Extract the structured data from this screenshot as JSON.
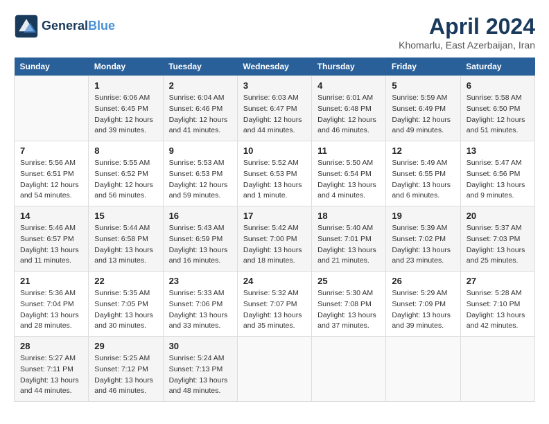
{
  "header": {
    "logo_line1": "General",
    "logo_line2": "Blue",
    "month_title": "April 2024",
    "subtitle": "Khomarlu, East Azerbaijan, Iran"
  },
  "weekdays": [
    "Sunday",
    "Monday",
    "Tuesday",
    "Wednesday",
    "Thursday",
    "Friday",
    "Saturday"
  ],
  "weeks": [
    [
      null,
      {
        "day": "1",
        "sunrise": "6:06 AM",
        "sunset": "6:45 PM",
        "daylight": "12 hours and 39 minutes."
      },
      {
        "day": "2",
        "sunrise": "6:04 AM",
        "sunset": "6:46 PM",
        "daylight": "12 hours and 41 minutes."
      },
      {
        "day": "3",
        "sunrise": "6:03 AM",
        "sunset": "6:47 PM",
        "daylight": "12 hours and 44 minutes."
      },
      {
        "day": "4",
        "sunrise": "6:01 AM",
        "sunset": "6:48 PM",
        "daylight": "12 hours and 46 minutes."
      },
      {
        "day": "5",
        "sunrise": "5:59 AM",
        "sunset": "6:49 PM",
        "daylight": "12 hours and 49 minutes."
      },
      {
        "day": "6",
        "sunrise": "5:58 AM",
        "sunset": "6:50 PM",
        "daylight": "12 hours and 51 minutes."
      }
    ],
    [
      {
        "day": "7",
        "sunrise": "5:56 AM",
        "sunset": "6:51 PM",
        "daylight": "12 hours and 54 minutes."
      },
      {
        "day": "8",
        "sunrise": "5:55 AM",
        "sunset": "6:52 PM",
        "daylight": "12 hours and 56 minutes."
      },
      {
        "day": "9",
        "sunrise": "5:53 AM",
        "sunset": "6:53 PM",
        "daylight": "12 hours and 59 minutes."
      },
      {
        "day": "10",
        "sunrise": "5:52 AM",
        "sunset": "6:53 PM",
        "daylight": "13 hours and 1 minute."
      },
      {
        "day": "11",
        "sunrise": "5:50 AM",
        "sunset": "6:54 PM",
        "daylight": "13 hours and 4 minutes."
      },
      {
        "day": "12",
        "sunrise": "5:49 AM",
        "sunset": "6:55 PM",
        "daylight": "13 hours and 6 minutes."
      },
      {
        "day": "13",
        "sunrise": "5:47 AM",
        "sunset": "6:56 PM",
        "daylight": "13 hours and 9 minutes."
      }
    ],
    [
      {
        "day": "14",
        "sunrise": "5:46 AM",
        "sunset": "6:57 PM",
        "daylight": "13 hours and 11 minutes."
      },
      {
        "day": "15",
        "sunrise": "5:44 AM",
        "sunset": "6:58 PM",
        "daylight": "13 hours and 13 minutes."
      },
      {
        "day": "16",
        "sunrise": "5:43 AM",
        "sunset": "6:59 PM",
        "daylight": "13 hours and 16 minutes."
      },
      {
        "day": "17",
        "sunrise": "5:42 AM",
        "sunset": "7:00 PM",
        "daylight": "13 hours and 18 minutes."
      },
      {
        "day": "18",
        "sunrise": "5:40 AM",
        "sunset": "7:01 PM",
        "daylight": "13 hours and 21 minutes."
      },
      {
        "day": "19",
        "sunrise": "5:39 AM",
        "sunset": "7:02 PM",
        "daylight": "13 hours and 23 minutes."
      },
      {
        "day": "20",
        "sunrise": "5:37 AM",
        "sunset": "7:03 PM",
        "daylight": "13 hours and 25 minutes."
      }
    ],
    [
      {
        "day": "21",
        "sunrise": "5:36 AM",
        "sunset": "7:04 PM",
        "daylight": "13 hours and 28 minutes."
      },
      {
        "day": "22",
        "sunrise": "5:35 AM",
        "sunset": "7:05 PM",
        "daylight": "13 hours and 30 minutes."
      },
      {
        "day": "23",
        "sunrise": "5:33 AM",
        "sunset": "7:06 PM",
        "daylight": "13 hours and 33 minutes."
      },
      {
        "day": "24",
        "sunrise": "5:32 AM",
        "sunset": "7:07 PM",
        "daylight": "13 hours and 35 minutes."
      },
      {
        "day": "25",
        "sunrise": "5:30 AM",
        "sunset": "7:08 PM",
        "daylight": "13 hours and 37 minutes."
      },
      {
        "day": "26",
        "sunrise": "5:29 AM",
        "sunset": "7:09 PM",
        "daylight": "13 hours and 39 minutes."
      },
      {
        "day": "27",
        "sunrise": "5:28 AM",
        "sunset": "7:10 PM",
        "daylight": "13 hours and 42 minutes."
      }
    ],
    [
      {
        "day": "28",
        "sunrise": "5:27 AM",
        "sunset": "7:11 PM",
        "daylight": "13 hours and 44 minutes."
      },
      {
        "day": "29",
        "sunrise": "5:25 AM",
        "sunset": "7:12 PM",
        "daylight": "13 hours and 46 minutes."
      },
      {
        "day": "30",
        "sunrise": "5:24 AM",
        "sunset": "7:13 PM",
        "daylight": "13 hours and 48 minutes."
      },
      null,
      null,
      null,
      null
    ]
  ]
}
